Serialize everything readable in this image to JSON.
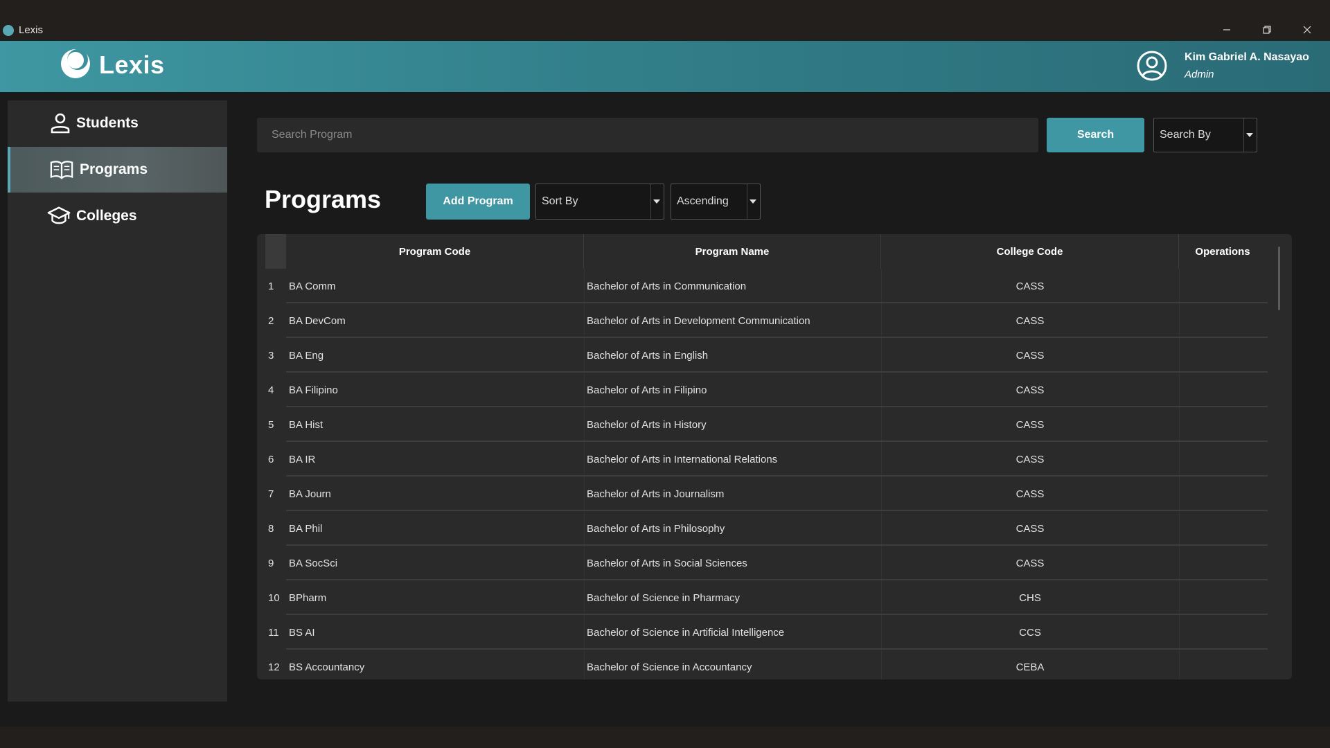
{
  "window": {
    "title": "Lexis"
  },
  "header": {
    "logo_text": "Lexis",
    "user_name": "Kim Gabriel A. Nasayao",
    "user_role": "Admin"
  },
  "sidebar": {
    "items": [
      {
        "label": "Students",
        "icon": "user-icon",
        "active": false
      },
      {
        "label": "Programs",
        "icon": "book-icon",
        "active": true
      },
      {
        "label": "Colleges",
        "icon": "graduation-cap-icon",
        "active": false
      }
    ]
  },
  "search": {
    "placeholder": "Search Program",
    "button_label": "Search",
    "search_by_label": "Search By"
  },
  "main": {
    "title": "Programs",
    "add_button_label": "Add Program",
    "sort_by_label": "Sort By",
    "order_label": "Ascending"
  },
  "table": {
    "columns": [
      "Program Code",
      "Program Name",
      "College Code",
      "Operations"
    ],
    "rows": [
      {
        "index": "1",
        "code": "BA Comm",
        "name": "Bachelor of Arts in Communication",
        "college": "CASS"
      },
      {
        "index": "2",
        "code": "BA DevCom",
        "name": "Bachelor of Arts in Development Communication",
        "college": "CASS"
      },
      {
        "index": "3",
        "code": "BA Eng",
        "name": "Bachelor of Arts in English",
        "college": "CASS"
      },
      {
        "index": "4",
        "code": "BA Filipino",
        "name": "Bachelor of Arts in Filipino",
        "college": "CASS"
      },
      {
        "index": "5",
        "code": "BA Hist",
        "name": "Bachelor of Arts in History",
        "college": "CASS"
      },
      {
        "index": "6",
        "code": "BA IR",
        "name": "Bachelor of Arts in International Relations",
        "college": "CASS"
      },
      {
        "index": "7",
        "code": "BA Journ",
        "name": "Bachelor of Arts in Journalism",
        "college": "CASS"
      },
      {
        "index": "8",
        "code": "BA Phil",
        "name": "Bachelor of Arts in Philosophy",
        "college": "CASS"
      },
      {
        "index": "9",
        "code": "BA SocSci",
        "name": "Bachelor of Arts in Social Sciences",
        "college": "CASS"
      },
      {
        "index": "10",
        "code": "BPharm",
        "name": "Bachelor of Science in Pharmacy",
        "college": "CHS"
      },
      {
        "index": "11",
        "code": "BS AI",
        "name": "Bachelor of Science in Artificial Intelligence",
        "college": "CCS"
      },
      {
        "index": "12",
        "code": "BS Accountancy",
        "name": "Bachelor of Science in Accountancy",
        "college": "CEBA"
      }
    ]
  },
  "colors": {
    "accent": "#3e97a2",
    "background": "#1a1a1a",
    "panel": "#2a2a2a",
    "titlebar": "#231f1c"
  }
}
